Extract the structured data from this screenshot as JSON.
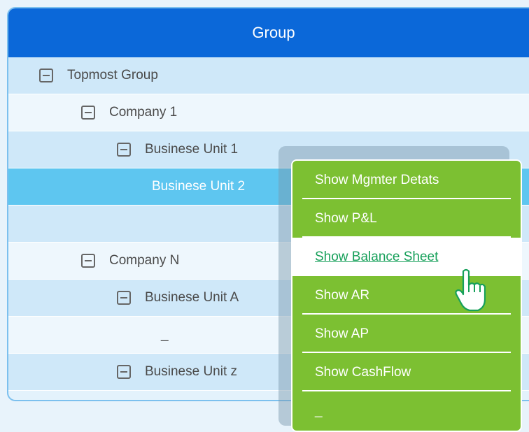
{
  "tree": {
    "header": "Group",
    "rows": [
      {
        "label": "Topmost Group"
      },
      {
        "label": "Company 1"
      },
      {
        "label": "Businese Unit 1"
      },
      {
        "label": "Businese Unit 2"
      },
      {
        "label": ""
      },
      {
        "label": "Company N"
      },
      {
        "label": "Businese Unit A"
      },
      {
        "label": "_"
      },
      {
        "label": "Businese Unit z"
      }
    ]
  },
  "context_menu": {
    "items": [
      {
        "label": "Show Mgmter Detats"
      },
      {
        "label": "Show P&L"
      },
      {
        "label": "Show Balance Sheet"
      },
      {
        "label": "Show AR"
      },
      {
        "label": "Show AP"
      },
      {
        "label": "Show CashFlow"
      },
      {
        "label": "_"
      }
    ]
  },
  "colors": {
    "header": "#0b68d9",
    "row_selected": "#5ec6f0",
    "menu": "#7cc032",
    "menu_hover_text": "#17a05a"
  },
  "icons": {
    "toggle": "collapse-minus-icon",
    "cursor": "hand-pointer-icon"
  }
}
